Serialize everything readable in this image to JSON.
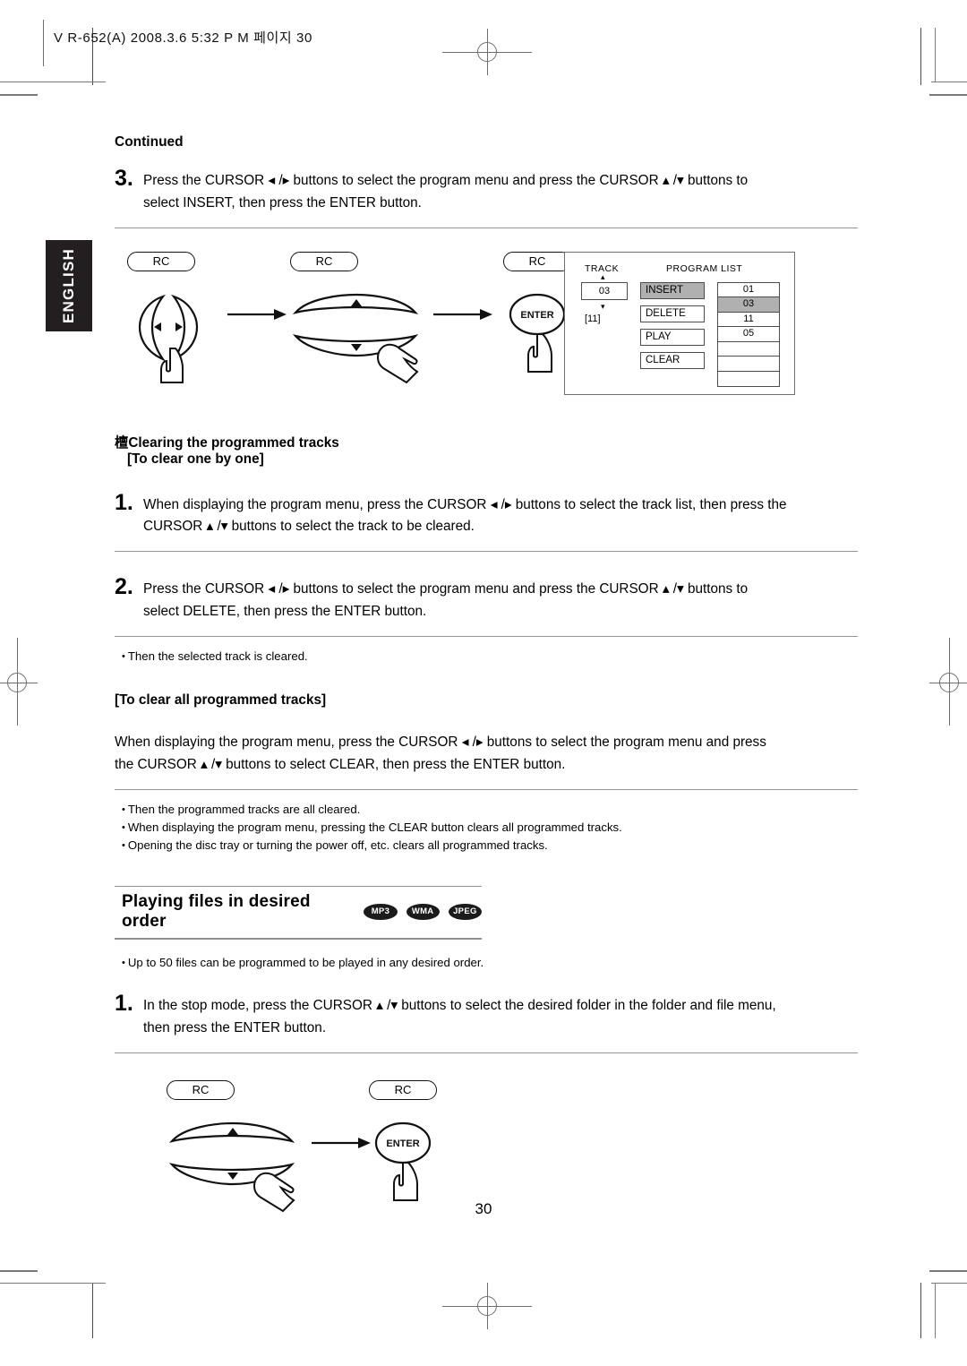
{
  "page": {
    "header_text": "V R-652(A)  2008.3.6  5:32 P M 페이지 30",
    "language_tab": "ENGLISH",
    "page_number": "30"
  },
  "content": {
    "continued_label": "Continued",
    "step3": {
      "number": "3.",
      "line1": "Press the CURSOR ◂ /▸   buttons to select the program menu and press the CURSOR ▴ /▾   buttons to",
      "line2": "select INSERT, then press the ENTER button."
    },
    "clearing_heading": {
      "bullet_glyph": "檀",
      "title": "Clearing the programmed tracks",
      "subtitle": "[To clear one by one]"
    },
    "step1_clear": {
      "number": "1.",
      "line1": "When displaying the program menu, press the CURSOR ◂ /▸   buttons to select the track list, then press the",
      "line2": "CURSOR ▴ /▾   buttons to select the track to be cleared."
    },
    "step2_clear": {
      "number": "2.",
      "line1": "Press the CURSOR ◂ /▸   buttons to select the program menu and press the CURSOR ▴ /▾   buttons to",
      "line2": "select DELETE, then press the ENTER button."
    },
    "note_after_step2": "Then the selected track is cleared.",
    "clear_all_heading": "[To clear all programmed tracks]",
    "clear_all_para": {
      "line1": "When displaying the program menu, press the CURSOR ◂ /▸   buttons to select the program menu and press",
      "line2": "the CURSOR ▴ /▾   buttons to select CLEAR, then press the ENTER button."
    },
    "clear_all_notes": [
      "Then the programmed tracks are all cleared.",
      "When displaying the program menu, pressing the CLEAR button clears all programmed tracks.",
      "Opening the disc tray or turning the power off, etc. clears all programmed tracks."
    ],
    "section": {
      "title": "Playing files in desired order",
      "badges": [
        "MP3",
        "WMA",
        "JPEG"
      ]
    },
    "section_note": "Up to 50 files can be programmed to be played in any desired order.",
    "step1_play": {
      "number": "1.",
      "line1": "In the stop mode, press the CURSOR ▴ /▾   buttons to select the desired folder in the folder and file menu,",
      "line2": "then press the ENTER button."
    }
  },
  "diagram_top": {
    "rc_labels": [
      "RC",
      "RC",
      "RC"
    ],
    "enter_label": "ENTER",
    "left_arrow_glyph": "◂",
    "right_arrow_glyph": "▸",
    "up_arrow_glyph": "▴",
    "down_arrow_glyph": "▾"
  },
  "diagram_bottom": {
    "rc_labels": [
      "RC",
      "RC"
    ],
    "enter_label": "ENTER",
    "up_arrow_glyph": "▴",
    "down_arrow_glyph": "▾"
  },
  "osd_panel": {
    "track_header": "TRACK",
    "program_list_header": "PROGRAM LIST",
    "track_up_arrow": "▴",
    "track_down_arrow": "▾",
    "track_value": "03",
    "track_total": "[11]",
    "menu_buttons": [
      {
        "label": "INSERT",
        "selected": true
      },
      {
        "label": "DELETE",
        "selected": false
      },
      {
        "label": "PLAY",
        "selected": false
      },
      {
        "label": "CLEAR",
        "selected": false
      }
    ],
    "program_rows": [
      {
        "value": "01",
        "selected": false
      },
      {
        "value": "03",
        "selected": true
      },
      {
        "value": "11",
        "selected": false
      },
      {
        "value": "05",
        "selected": false
      },
      {
        "value": "",
        "selected": false
      },
      {
        "value": "",
        "selected": false
      },
      {
        "value": "",
        "selected": false
      }
    ]
  },
  "colors": {
    "highlight": "#b0b0b0",
    "rule": "#949494",
    "tab_bg": "#231f20"
  }
}
